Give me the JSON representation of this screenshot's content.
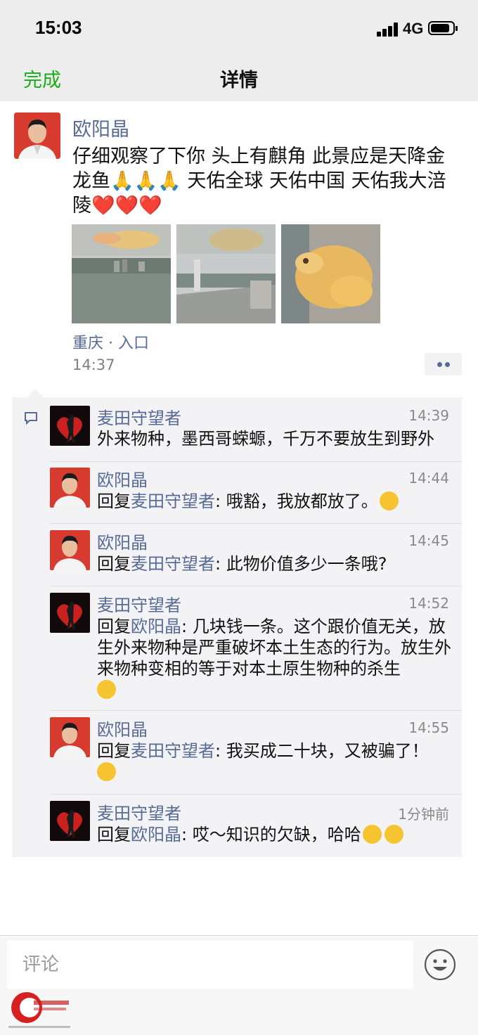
{
  "status_bar": {
    "time": "15:03",
    "network": "4G",
    "battery_level": 0.85
  },
  "nav": {
    "done_label": "完成",
    "title": "详情"
  },
  "post": {
    "author": "欧阳晶",
    "text": "仔细观察了下你  头上有麒角  此景应是天降金龙鱼🙏🙏🙏   天佑全球   天佑中国   天佑我大涪陵❤️❤️❤️",
    "location": "重庆 · 入口",
    "time": "14:37",
    "photos": [
      "photo-fish-lake",
      "photo-fish-promenade",
      "photo-fish-closeup"
    ]
  },
  "comments": [
    {
      "author": "麦田守望者",
      "time": "14:39",
      "text": "外来物种，墨西哥蝾螈，千万不要放生到野外"
    },
    {
      "author": "欧阳晶",
      "time": "14:44",
      "reply_prefix": "回复",
      "reply_to": "麦田守望者",
      "text": ": 哦豁，我放都放了。"
    },
    {
      "author": "欧阳晶",
      "time": "14:45",
      "reply_prefix": "回复",
      "reply_to": "麦田守望者",
      "text": ": 此物价值多少一条哦?"
    },
    {
      "author": "麦田守望者",
      "time": "14:52",
      "reply_prefix": "回复",
      "reply_to": "欧阳晶",
      "text": ": 几块钱一条。这个跟价值无关，放生外来物种是严重破坏本土生态的行为。放生外来物种变相的等于对本土原生物种的杀生"
    },
    {
      "author": "欧阳晶",
      "time": "14:55",
      "reply_prefix": "回复",
      "reply_to": "麦田守望者",
      "text": ": 我买成二十块，又被骗了！"
    },
    {
      "author": "麦田守望者",
      "time": "1分钟前",
      "reply_prefix": "回复",
      "reply_to": "欧阳晶",
      "text": ": 哎～知识的欠缺，哈哈"
    }
  ],
  "input": {
    "placeholder": "评论"
  },
  "colors": {
    "accent_green": "#1aad19",
    "link_blue": "#576b95",
    "nav_bg": "#ededed",
    "comment_bg": "#f3f3f5"
  },
  "icons": [
    "comment-bubble-icon",
    "emoji-smiley-icon",
    "more-dots-icon"
  ]
}
